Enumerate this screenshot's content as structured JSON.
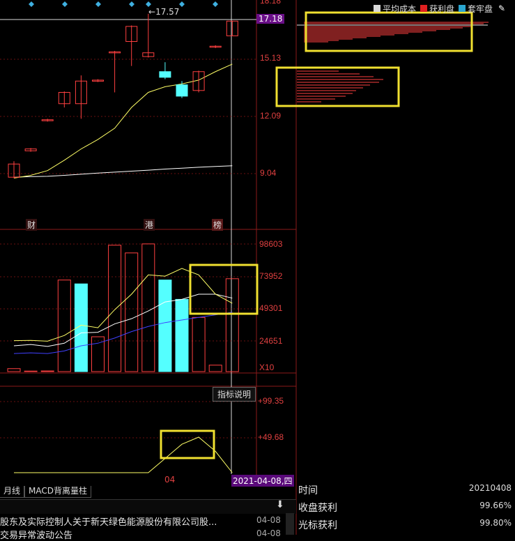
{
  "price_axis": {
    "labels": [
      "18.18",
      "15.13",
      "12.09",
      "9.04"
    ],
    "current": "17.18",
    "peak_label": "17.57"
  },
  "volume_axis": {
    "labels": [
      "98603",
      "73952",
      "49301",
      "24651"
    ],
    "scale_label": "X10"
  },
  "indicator_axis": {
    "labels": [
      "+99.35",
      "+49.68"
    ],
    "desc_button": "指标说明",
    "x_label": "04",
    "date_tag": "2021-04-08,四"
  },
  "events": [
    "财",
    "港",
    "榜"
  ],
  "legend": [
    {
      "label": "平均成本",
      "color": "#d8d8d8"
    },
    {
      "label": "获利盘",
      "color": "#e02020"
    },
    {
      "label": "套牢盘",
      "color": "#2aa6d0"
    }
  ],
  "tabs": [
    "月线",
    "MACD背离量柱"
  ],
  "news": [
    {
      "title": "股东及实际控制人关于新天绿色能源股份有限公司股...",
      "date": "04-08"
    },
    {
      "title": "交易异常波动公告",
      "date": "04-08"
    }
  ],
  "info_panel": [
    {
      "key": "时间",
      "value": "20210408"
    },
    {
      "key": "收盘获利",
      "value": "99.66%"
    },
    {
      "key": "光标获利",
      "value": "99.80%"
    }
  ],
  "colors": {
    "up": "#ff4040",
    "down": "#54ffff",
    "ma_short": "#ffff66",
    "ma_long": "#ffffff",
    "ma_vol_long": "#4040ff",
    "highlight": "#f0e030"
  },
  "chart_data": {
    "type": "candlestick",
    "price_candles": [
      {
        "open": 8.9,
        "close": 9.6,
        "high": 9.75,
        "low": 8.85
      },
      {
        "open": 10.3,
        "close": 10.4,
        "high": 10.45,
        "low": 10.25
      },
      {
        "open": 11.9,
        "close": 11.95,
        "high": 12.0,
        "low": 11.85
      },
      {
        "open": 12.8,
        "close": 13.4,
        "high": 13.45,
        "low": 12.6
      },
      {
        "open": 12.8,
        "close": 14.0,
        "high": 14.3,
        "low": 12.0
      },
      {
        "open": 14.0,
        "close": 14.05,
        "high": 14.1,
        "low": 13.95
      },
      {
        "open": 15.5,
        "close": 15.55,
        "high": 15.6,
        "low": 13.4
      },
      {
        "open": 16.1,
        "close": 16.9,
        "high": 16.95,
        "low": 14.8
      },
      {
        "open": 15.3,
        "close": 15.5,
        "high": 17.57,
        "low": 15.25
      },
      {
        "open": 14.5,
        "close": 14.2,
        "high": 15.0,
        "low": 14.1
      },
      {
        "open": 13.8,
        "close": 13.2,
        "high": 14.0,
        "low": 13.1
      },
      {
        "open": 13.5,
        "close": 14.5,
        "high": 14.55,
        "low": 13.4
      },
      {
        "open": 15.8,
        "close": 15.85,
        "high": 15.9,
        "low": 15.75
      },
      {
        "open": 16.4,
        "close": 17.18,
        "high": 17.2,
        "low": 16.4
      }
    ],
    "price_ma_short": [
      8.85,
      9.0,
      9.25,
      9.8,
      10.4,
      10.9,
      11.5,
      12.6,
      13.4,
      13.7,
      13.85,
      14.05,
      14.5,
      14.9
    ],
    "price_ma_long": [
      8.9,
      8.93,
      8.95,
      9.0,
      9.06,
      9.12,
      9.17,
      9.22,
      9.27,
      9.33,
      9.38,
      9.43,
      9.47,
      9.51
    ],
    "volumes": [
      {
        "value": 2300,
        "up": true
      },
      {
        "value": 400,
        "up": true
      },
      {
        "value": 500,
        "up": true
      },
      {
        "value": 71000,
        "up": true
      },
      {
        "value": 68000,
        "up": false
      },
      {
        "value": 27000,
        "up": true
      },
      {
        "value": 98000,
        "up": true
      },
      {
        "value": 92000,
        "up": true
      },
      {
        "value": 99000,
        "up": true
      },
      {
        "value": 71000,
        "up": false
      },
      {
        "value": 56000,
        "up": false
      },
      {
        "value": 42000,
        "up": true
      },
      {
        "value": 5000,
        "up": true
      },
      {
        "value": 72000,
        "up": true
      }
    ],
    "volume_ma_short": [
      24000,
      24200,
      23600,
      28000,
      36000,
      34000,
      48000,
      60000,
      75000,
      74000,
      80000,
      75000,
      60000,
      53000
    ],
    "volume_ma_mid": [
      20000,
      21000,
      19500,
      22000,
      30000,
      30500,
      37000,
      41000,
      47000,
      54000,
      56000,
      60000,
      60000,
      57000
    ],
    "volume_ma_long": [
      14000,
      14500,
      14000,
      16000,
      20000,
      22000,
      26000,
      31000,
      35000,
      38000,
      40000,
      42000,
      44000,
      46000
    ],
    "indicator": [
      0,
      0,
      0,
      0,
      0,
      0,
      0,
      0,
      0,
      20,
      40,
      50,
      30,
      0
    ],
    "price_range": [
      8.5,
      18.3
    ],
    "volume_range": [
      0,
      100000
    ],
    "indicator_range": [
      0,
      100
    ]
  }
}
